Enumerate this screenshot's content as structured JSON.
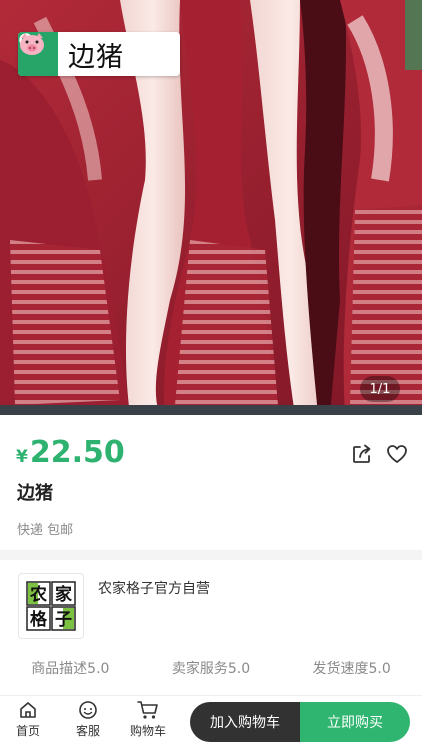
{
  "product_image": {
    "overlay_tag": "边猪",
    "overlay_icon": "search-icon",
    "overlay_emoji": "pig-face-icon",
    "counter": "1/1"
  },
  "product": {
    "currency": "¥",
    "price": "22.50",
    "title": "边猪",
    "shipping": "快递 包邮",
    "actions": [
      "share-icon",
      "heart-icon"
    ]
  },
  "shop": {
    "name": "农家格子官方自营",
    "logo_chars": [
      "农",
      "家",
      "格",
      "子"
    ],
    "ratings": [
      {
        "label": "商品描述5.0"
      },
      {
        "label": "卖家服务5.0"
      },
      {
        "label": "发货速度5.0"
      }
    ]
  },
  "bottom_nav": {
    "home": "首页",
    "service": "客服",
    "cart": "购物车",
    "add_to_cart": "加入购物车",
    "buy_now": "立即购买"
  },
  "colors": {
    "accent_green": "#2db26f",
    "dark_button": "#323232",
    "tag_green": "#27a468"
  }
}
